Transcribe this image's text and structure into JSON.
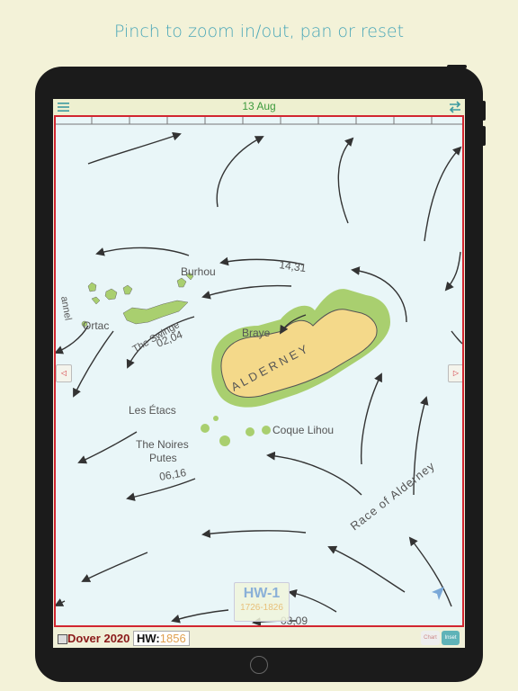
{
  "caption": "Pinch to zoom in/out, pan or reset",
  "topbar": {
    "date": "13 Aug"
  },
  "map": {
    "labels": {
      "burhou": "Burhou",
      "ortac": "Ortac",
      "swinge": "The Swinge",
      "braye": "Braye",
      "alderney": "A L D E R N E Y",
      "etacs": "Les Étacs",
      "noires1": "The Noires",
      "noires2": "Putes",
      "coque": "Coque Lihou",
      "race": "Race of Alderney",
      "channel": "annel"
    },
    "rates": [
      "14,31",
      "02,04",
      "06,16",
      "03,09"
    ],
    "hw": {
      "title": "HW-1",
      "range": "1726-1826"
    }
  },
  "bottombar": {
    "port": "Dover 2020",
    "hw_label": "HW:",
    "hw_value": "1856",
    "chart_label": "Chart",
    "inset_label": "Inset"
  },
  "colors": {
    "accent": "#4aa7b8",
    "frame": "#d22630",
    "land": "#f4d98a",
    "shore": "#a9cf6f"
  }
}
